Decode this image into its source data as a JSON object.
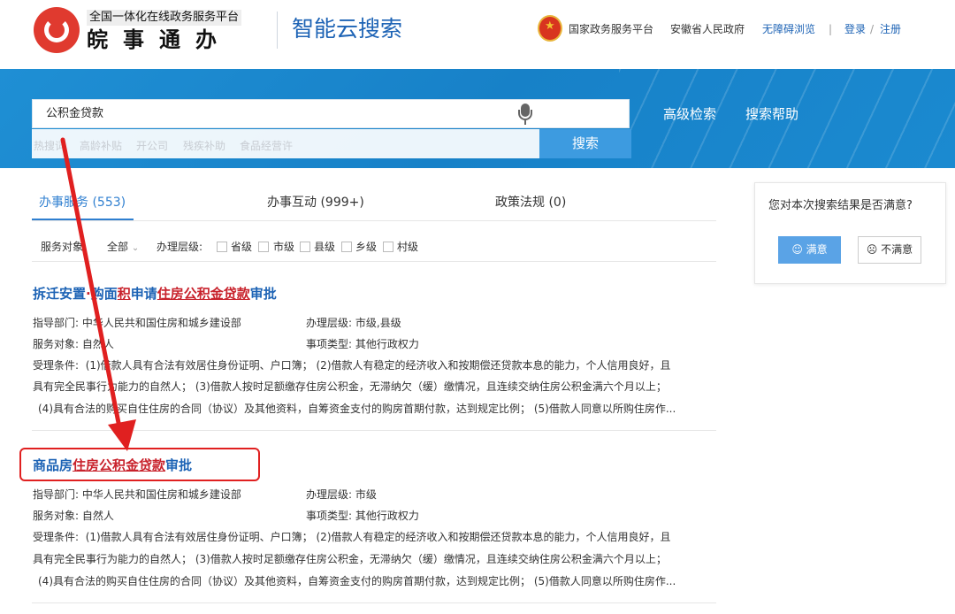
{
  "header": {
    "logo_sub": "全国一体化在线政务服务平台",
    "logo_main": "皖事通办",
    "site_title": "智能云搜索",
    "links": {
      "national": "国家政务服务平台",
      "provincial": "安徽省人民政府",
      "accessibility": "无障碍浏览",
      "separator": "|",
      "login": "登录",
      "slash": "/",
      "register": "注册"
    }
  },
  "search": {
    "query": "公积金贷款",
    "button": "搜索",
    "hot_words": [
      "热搜词",
      "高龄补贴",
      "开公司",
      "残疾补助",
      "食品经营许"
    ],
    "advanced": "高级检索",
    "help": "搜索帮助"
  },
  "tabs": [
    {
      "label": "办事服务 (553)",
      "active": true
    },
    {
      "label": "办事互动 (999+)",
      "active": false
    },
    {
      "label": "政策法规 (0)",
      "active": false
    }
  ],
  "filters": {
    "target_label": "服务对象:",
    "target_value": "全部",
    "level_label": "办理层级:",
    "levels": [
      "省级",
      "市级",
      "县级",
      "乡级",
      "村级"
    ]
  },
  "results": [
    {
      "title_parts": [
        "拆迁安置",
        "·",
        "购面",
        "积",
        "申请",
        "住房公积金贷款",
        "审批"
      ],
      "dept_label": "指导部门:",
      "dept": "中华人民共和国住房和城乡建设部",
      "level_label": "办理层级:",
      "level": "市级,县级",
      "target_label": "服务对象:",
      "target": "自然人",
      "type_label": "事项类型:",
      "type": "其他行政权力",
      "cond_label": "受理条件:",
      "cond_1": "(1)借款人具有合法有效居住身份证明、户口簿；  (2)借款人有稳定的经济收入和按期偿还贷款本息的能力，个人信用良好，且",
      "cond_2": "具有完全民事行为能力的自然人；  (3)借款人按时足额缴存住房公积金，无滞纳欠（缓）缴情况，且连续交纳住房公积金满六个月以上；",
      "cond_3": "(4)具有合法的购买自住住房的合同（协议）及其他资料，自筹资金支付的购房首期付款，达到规定比例；  (5)借款人同意以所购住房作..."
    },
    {
      "title_parts": [
        "商品房",
        "住房公积金贷款",
        "审批"
      ],
      "dept_label": "指导部门:",
      "dept": "中华人民共和国住房和城乡建设部",
      "level_label": "办理层级:",
      "level": "市级",
      "target_label": "服务对象:",
      "target": "自然人",
      "type_label": "事项类型:",
      "type": "其他行政权力",
      "cond_label": "受理条件:",
      "cond_1": "(1)借款人具有合法有效居住身份证明、户口簿；  (2)借款人有稳定的经济收入和按期偿还贷款本息的能力，个人信用良好，且",
      "cond_2": "具有完全民事行为能力的自然人；  (3)借款人按时足额缴存住房公积金，无滞纳欠（缓）缴情况，且连续交纳住房公积金满六个月以上；",
      "cond_3": "(4)具有合法的购买自住住房的合同（协议）及其他资料，自筹资金支付的购房首期付款，达到规定比例；  (5)借款人同意以所购住房作..."
    }
  ],
  "feedback": {
    "question": "您对本次搜索结果是否满意?",
    "yes": "满意",
    "no": "不满意"
  },
  "colors": {
    "brand_blue": "#1d63b5",
    "banner_blue": "#1a87cc",
    "keyword_red": "#c8222c",
    "annotation_red": "#e02020"
  },
  "icons": [
    "logo-icon",
    "national-emblem-icon",
    "microphone-icon",
    "smile-icon",
    "frown-icon",
    "chevron-down-icon",
    "annotation-arrow-icon"
  ]
}
